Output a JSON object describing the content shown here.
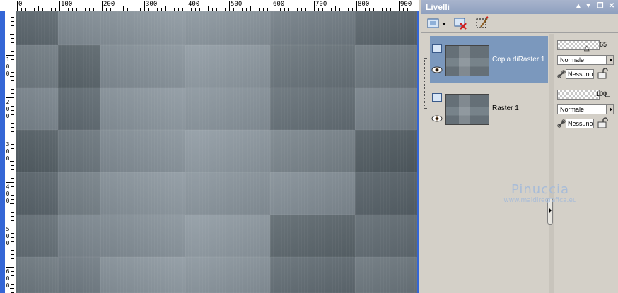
{
  "ruler": {
    "top_labels": [
      "0",
      "100",
      "200",
      "300",
      "400",
      "500",
      "600",
      "700",
      "800",
      "900"
    ],
    "left_labels": [
      [
        "1",
        "0",
        "0"
      ],
      [
        "2",
        "0",
        "0"
      ],
      [
        "3",
        "0",
        "0"
      ],
      [
        "4",
        "0",
        "0"
      ],
      [
        "5",
        "0",
        "0"
      ],
      [
        "6",
        "0",
        "0"
      ]
    ]
  },
  "panel": {
    "title": "Livelli",
    "title_buttons": [
      "pin-icon",
      "dropdown-icon",
      "restore-icon",
      "close-icon"
    ],
    "toolbar": [
      "new-layer-icon",
      "delete-layer-icon",
      "edit-selection-icon"
    ]
  },
  "layers": [
    {
      "name": "Copia diRaster 1",
      "visible": true,
      "selected": true,
      "opacity": "65",
      "blend_mode": "Normale",
      "mask": "Nessuno"
    },
    {
      "name": "Raster 1",
      "visible": true,
      "selected": false,
      "opacity": "100",
      "blend_mode": "Normale",
      "mask": "Nessuno"
    }
  ],
  "watermark": {
    "name": "Pinuccia",
    "url": "www.maidiregrafica.eu"
  },
  "colors": {
    "canvas_base": "#6f7b83",
    "selected_layer": "#7b98bd",
    "ruler_accent": "#3466d6"
  }
}
